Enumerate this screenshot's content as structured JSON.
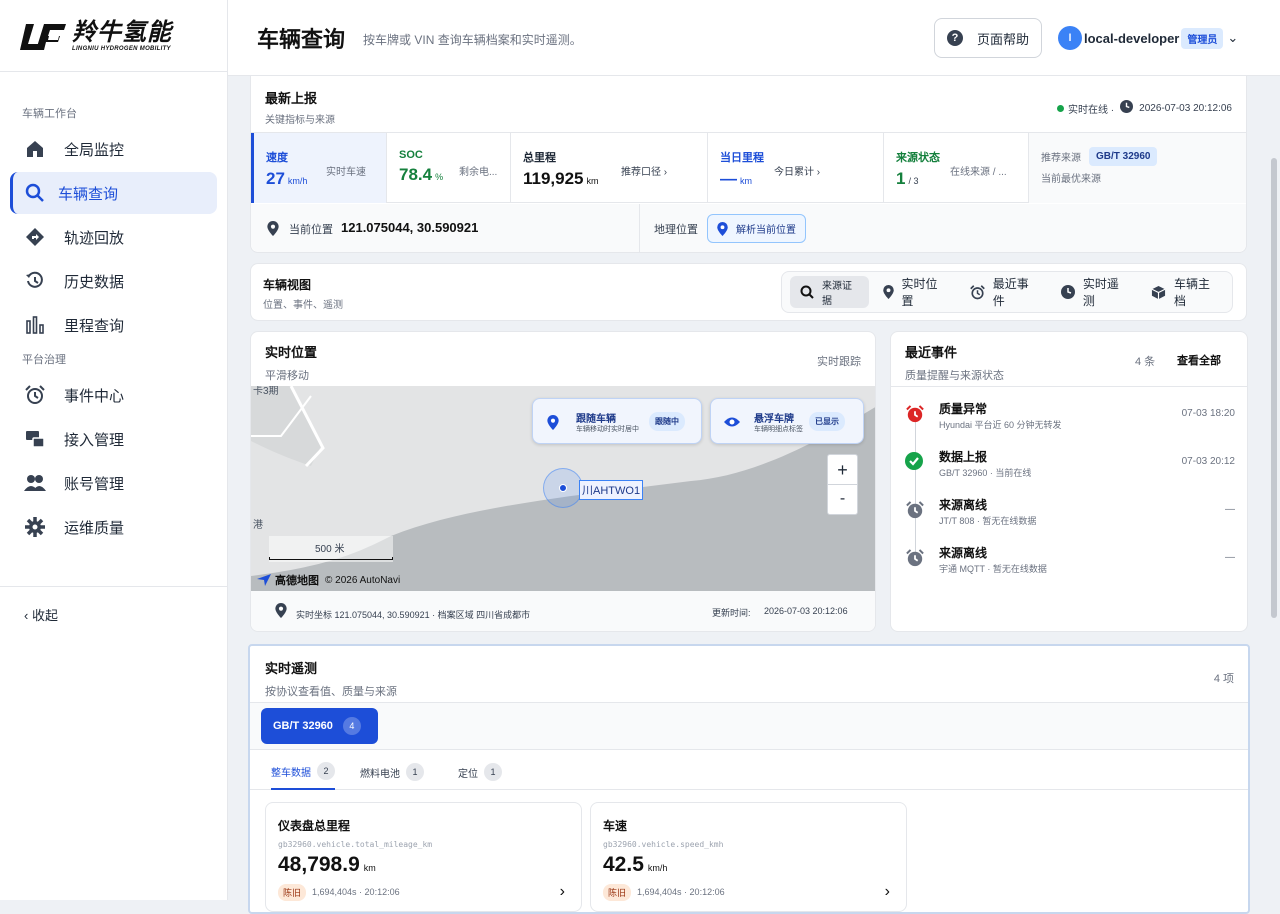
{
  "brand": {
    "name_cn": "羚牛氢能",
    "name_en": "LINGNIU HYDROGEN MOBILITY"
  },
  "sidebar": {
    "section1": "车辆工作台",
    "section2": "平台治理",
    "items": [
      {
        "label": "全局监控",
        "icon": "home-icon"
      },
      {
        "label": "车辆查询",
        "icon": "search-icon",
        "active": true
      },
      {
        "label": "轨迹回放",
        "icon": "route-icon"
      },
      {
        "label": "历史数据",
        "icon": "history-icon"
      },
      {
        "label": "里程查询",
        "icon": "bar-chart-icon"
      },
      {
        "label": "事件中心",
        "icon": "alarm-icon"
      },
      {
        "label": "接入管理",
        "icon": "connection-icon"
      },
      {
        "label": "账号管理",
        "icon": "users-icon"
      },
      {
        "label": "运维质量",
        "icon": "gear-icon"
      }
    ],
    "collapse_label": "收起"
  },
  "header": {
    "title": "车辆查询",
    "subtitle": "按车牌或 VIN 查询车辆档案和实时遥测。",
    "help_label": "页面帮助",
    "user_initial": "l",
    "user_name": "local-developer",
    "role": "管理员"
  },
  "latest": {
    "title": "最新上报",
    "subtitle": "关键指标与来源",
    "status": "实时在线 ·",
    "time": "2026-07-03 20:12:06",
    "metrics": [
      {
        "label": "速度",
        "value": "27",
        "unit": "km/h",
        "hint": "实时车速",
        "color": "#1d4ed8"
      },
      {
        "label": "SOC",
        "value": "78.4",
        "unit": "%",
        "hint": "剩余电...",
        "color": "#15803d"
      },
      {
        "label": "总里程",
        "value": "119,925",
        "unit": "km",
        "hint": "推荐口径 ›",
        "color": "#111827"
      },
      {
        "label": "当日里程",
        "value": "—",
        "unit": "km",
        "hint": "今日累计 ›",
        "color": "#1d4ed8"
      },
      {
        "label": "来源状态",
        "value": "1",
        "unit": "/ 3",
        "hint": "在线来源 / ...",
        "color": "#15803d"
      }
    ],
    "recommend_label": "推荐来源",
    "recommend_chip": "GB/T 32960",
    "recommend_desc": "当前最优来源",
    "position_label": "当前位置",
    "position_value": "121.075044, 30.590921",
    "geo_label": "地理位置",
    "geo_button": "解析当前位置"
  },
  "vehicle_view": {
    "title": "车辆视图",
    "subtitle": "位置、事件、遥测",
    "tools": [
      {
        "label": "来源证据",
        "icon": "search-icon"
      },
      {
        "label": "实时位置",
        "icon": "pin-icon"
      },
      {
        "label": "最近事件",
        "icon": "alarm-icon"
      },
      {
        "label": "实时遥测",
        "icon": "clock-icon"
      },
      {
        "label": "车辆主档",
        "icon": "cube-icon"
      }
    ]
  },
  "realtime_location": {
    "title": "实时位置",
    "subtitle": "平滑移动",
    "status": "实时跟踪",
    "follow_title": "跟随车辆",
    "follow_desc": "车辆移动时实时居中",
    "follow_badge": "跟随中",
    "float_title": "悬浮车牌",
    "float_desc": "车辆明细点标签",
    "float_badge": "已显示",
    "plate": "川AHTWO1",
    "zoom_in": "+",
    "zoom_out": "-",
    "scale": "500 米",
    "map_brand": "高德地图",
    "copyright": "© 2026 AutoNavi",
    "map_label_left": "港",
    "map_label_top": "卡3期",
    "footer_coord": "实时坐标 121.075044, 30.590921 · 档案区域 四川省成都市",
    "footer_update_label": "更新时间:",
    "footer_update_time": "2026-07-03 20:12:06"
  },
  "events": {
    "title": "最近事件",
    "subtitle": "质量提醒与来源状态",
    "count": "4 条",
    "view_all": "查看全部",
    "items": [
      {
        "title": "质量异常",
        "desc": "Hyundai 平台近 60 分钟无转发",
        "time": "07-03 18:20",
        "color": "#dc2626",
        "icon": "alarm-icon"
      },
      {
        "title": "数据上报",
        "desc": "GB/T 32960 · 当前在线",
        "time": "07-03 20:12",
        "color": "#16a34a",
        "icon": "check-icon"
      },
      {
        "title": "来源离线",
        "desc": "JT/T 808 · 暂无在线数据",
        "time": "—",
        "color": "#6b7280",
        "icon": "alarm-icon"
      },
      {
        "title": "来源离线",
        "desc": "宇通 MQTT · 暂无在线数据",
        "time": "—",
        "color": "#6b7280",
        "icon": "alarm-icon"
      }
    ]
  },
  "telemetry": {
    "title": "实时遥测",
    "subtitle": "按协议查看值、质量与来源",
    "count": "4 项",
    "protocol": "GB/T 32960",
    "protocol_count": "4",
    "tabs": [
      {
        "label": "整车数据",
        "count": "2",
        "active": true
      },
      {
        "label": "燃料电池",
        "count": "1"
      },
      {
        "label": "定位",
        "count": "1"
      }
    ],
    "cards": [
      {
        "title": "仪表盘总里程",
        "key": "gb32960.vehicle.total_mileage_km",
        "value": "48,798.9",
        "unit": "km",
        "stale": "陈旧",
        "meta": "1,694,404s · 20:12:06"
      },
      {
        "title": "车速",
        "key": "gb32960.vehicle.speed_kmh",
        "value": "42.5",
        "unit": "km/h",
        "stale": "陈旧",
        "meta": "1,694,404s · 20:12:06"
      }
    ]
  }
}
